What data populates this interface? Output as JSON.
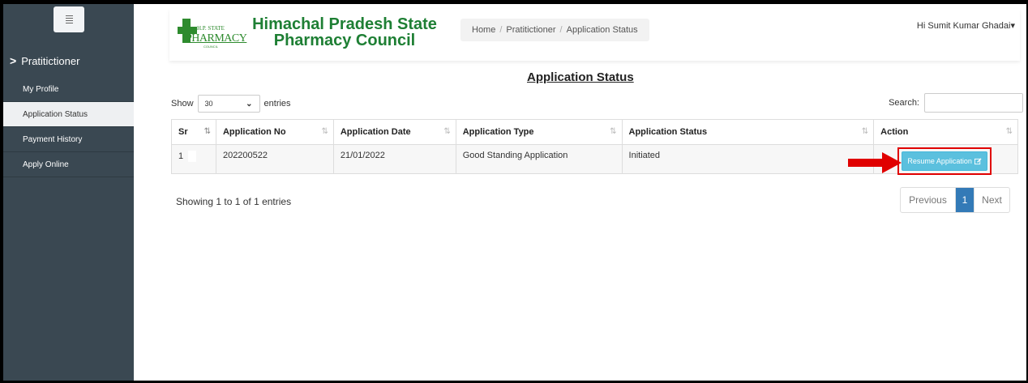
{
  "sidebar": {
    "section_label": "Pratitictioner",
    "items": [
      {
        "label": "My Profile"
      },
      {
        "label": "Application Status"
      },
      {
        "label": "Payment History"
      },
      {
        "label": "Apply Online"
      }
    ]
  },
  "header": {
    "logo": {
      "hp_text": "H.P. STATE",
      "pharmacy_text": "PHARMACY",
      "council_text": "COUNCIL"
    },
    "org_name": "Himachal Pradesh State Pharmacy Council",
    "breadcrumb": [
      "Home",
      "Pratitictioner",
      "Application Status"
    ],
    "user_greeting": "Hi Sumit Kumar Ghadai"
  },
  "page": {
    "title": "Application Status",
    "show_label": "Show",
    "entries_label": "entries",
    "page_length": "30",
    "search_label": "Search:",
    "search_value": ""
  },
  "table": {
    "columns": [
      "Sr",
      "Application No",
      "Application Date",
      "Application Type",
      "Application Status",
      "Action"
    ],
    "rows": [
      {
        "sr": "1",
        "app_no": "202200522",
        "date": "21/01/2022",
        "type": "Good Standing Application",
        "status": "Initiated",
        "action": "Resume Application"
      }
    ]
  },
  "info_text": "Showing 1 to 1 of 1 entries",
  "pagination": {
    "previous": "Previous",
    "current": "1",
    "next": "Next"
  },
  "colors": {
    "sidebar_bg": "#3a4852",
    "brand_green": "#1e7f34",
    "action_btn": "#5bc0de",
    "highlight": "#e00000",
    "pager_active": "#337ab7"
  }
}
